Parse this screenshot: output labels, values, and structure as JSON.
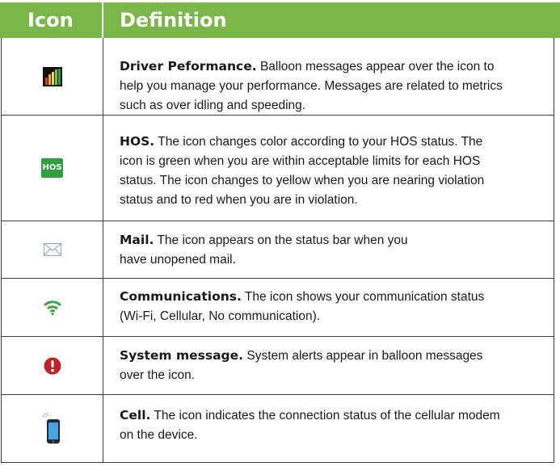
{
  "header": {
    "col_icon": "Icon",
    "col_definition": "Definition"
  },
  "rows": [
    {
      "icon": "driver-performance-icon",
      "term": "Driver Peformance.",
      "lines": [
        "Balloon messages appear over the icon to",
        "help you manage your performance. Messages are related to metrics",
        "such as over idling and speeding."
      ]
    },
    {
      "icon": "hos-icon",
      "icon_text": "HOS",
      "term": "HOS.",
      "lines": [
        "The icon changes color according to your HOS status. The",
        "icon is green when you are within acceptable limits for each HOS",
        "status. The icon changes to yellow when you are nearing violation",
        "status and to red when you are in violation."
      ]
    },
    {
      "icon": "mail-icon",
      "term": "Mail.",
      "lines": [
        "The icon appears on the status bar when you",
        "have unopened mail."
      ]
    },
    {
      "icon": "wifi-icon",
      "term": "Communications.",
      "lines": [
        "The icon shows your communication status",
        "(Wi-Fi, Cellular, No communication)."
      ]
    },
    {
      "icon": "system-message-icon",
      "term": "System message.",
      "lines": [
        "System alerts appear in balloon messages",
        "over the icon."
      ]
    },
    {
      "icon": "cell-phone-icon",
      "term": "Cell.",
      "lines": [
        "The icon indicates the connection status of the cellular modem",
        "on the device."
      ]
    }
  ],
  "colors": {
    "header_bg": "#7ab648",
    "hos_green": "#2e9e3e",
    "alert_red": "#c0202a",
    "wifi_green": "#3aa34a"
  }
}
